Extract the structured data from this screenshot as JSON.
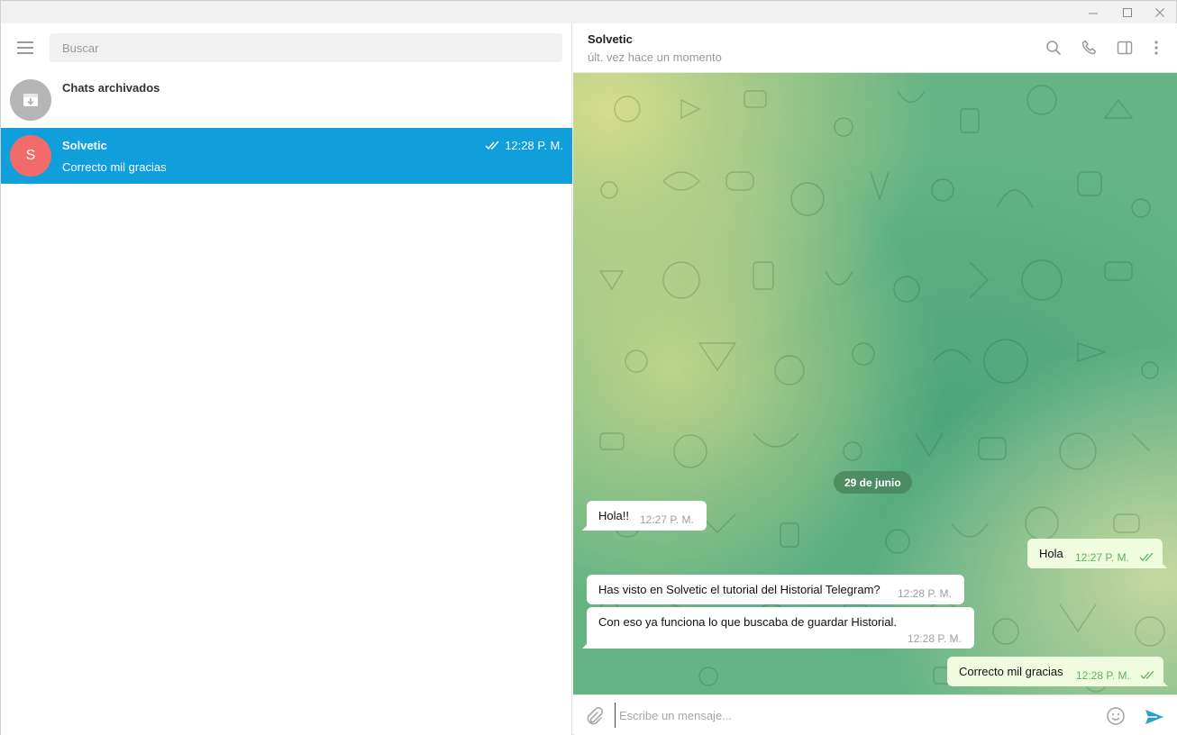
{
  "sidebar": {
    "search_placeholder": "Buscar",
    "archived": {
      "label": "Chats archivados"
    },
    "chats": [
      {
        "avatar_letter": "S",
        "name": "Solvetic",
        "preview": "Correcto mil gracias",
        "time": "12:28 P. M."
      }
    ]
  },
  "chat": {
    "name": "Solvetic",
    "status": "últ. vez hace un momento",
    "date_label": "29 de junio",
    "messages": [
      {
        "direction": "in",
        "text": "Hola!!",
        "time": "12:27 P. M."
      },
      {
        "direction": "out",
        "text": "Hola",
        "time": "12:27 P. M."
      },
      {
        "direction": "in",
        "text": "Has visto en Solvetic el tutorial del Historial Telegram?",
        "time": "12:28 P. M."
      },
      {
        "direction": "in",
        "text": "Con eso ya funciona lo que buscaba de guardar Historial.",
        "time": "12:28 P. M."
      },
      {
        "direction": "out",
        "text": "Correcto mil gracias",
        "time": "12:28 P. M."
      }
    ],
    "composer_placeholder": "Escribe un mensaje..."
  },
  "icons": {
    "menu": "hamburger-menu-icon",
    "archive": "archive-box-icon",
    "search": "search-icon",
    "call": "phone-icon",
    "sidebar_toggle": "sidebar-panel-icon",
    "more": "more-vertical-icon",
    "attach": "paperclip-icon",
    "emoji": "smiley-icon",
    "send": "send-icon",
    "read": "double-check-icon"
  },
  "colors": {
    "active_row": "#109fdb",
    "avatar": "#f26b6b",
    "outgoing_bubble": "#effdde",
    "read_check": "#5fb15f"
  }
}
